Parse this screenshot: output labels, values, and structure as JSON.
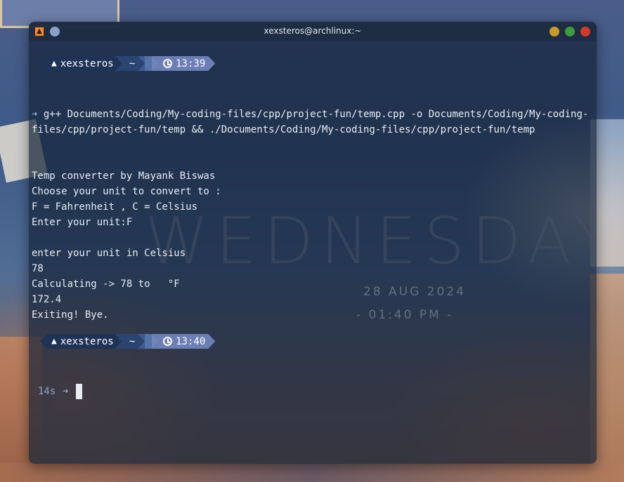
{
  "window": {
    "title": "xexsteros@archlinux:~"
  },
  "desktop_clock": {
    "day": "WEDNESDAY",
    "date": "28 AUG 2024",
    "time": "- 01:40 PM -"
  },
  "prompt1": {
    "user": "xexsteros",
    "dir": "~",
    "time": "13:39"
  },
  "command": {
    "arrow": "➜",
    "text": "g++ Documents/Coding/My-coding-files/cpp/project-fun/temp.cpp -o Documents/Coding/My-coding-files/cpp/project-fun/temp && ./Documents/Coding/My-coding-files/cpp/project-fun/temp"
  },
  "output": [
    "Temp converter by Mayank Biswas",
    "Choose your unit to convert to :",
    "F = Fahrenheit , C = Celsius",
    "Enter your unit:F",
    "",
    "enter your unit in Celsius",
    "78",
    "Calculating -> 78 to   °F",
    "172.4",
    "Exiting! Bye."
  ],
  "prompt2": {
    "user": "xexsteros",
    "dir": "~",
    "time": "13:40"
  },
  "current_prompt": {
    "elapsed": "14s",
    "arrow": "➜"
  }
}
